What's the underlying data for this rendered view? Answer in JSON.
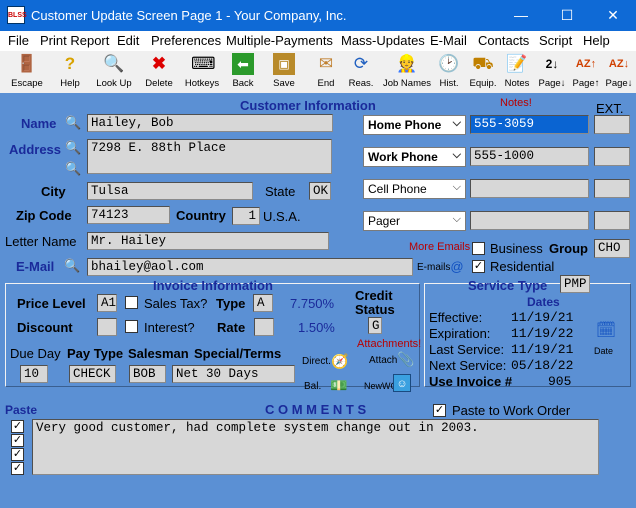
{
  "window": {
    "title": "Customer Update Screen Page 1 - Your Company, Inc.",
    "app_icon_text": "BLSS",
    "minimize": "—",
    "maximize": "☐",
    "close": "✕"
  },
  "menu": [
    "File",
    "Print Report",
    "Edit",
    "Preferences",
    "Multiple-Payments",
    "Mass-Updates",
    "E-Mail",
    "Contacts",
    "Script",
    "Help"
  ],
  "toolbar": {
    "escape": "Escape",
    "help": "Help",
    "lookup": "Look Up",
    "delete": "Delete",
    "hotkeys": "Hotkeys",
    "back": "Back",
    "save": "Save",
    "end": "End",
    "reas": "Reas.",
    "jobnames": "Job Names",
    "hist": "Hist.",
    "equip": "Equip.",
    "notes": "Notes",
    "page_down": "Page↓",
    "page_up": "Page↑",
    "page_down2": "Page↓"
  },
  "customer": {
    "section_title": "Customer Information",
    "name_label": "Name",
    "name": "Hailey, Bob",
    "address_label": "Address",
    "address": "7298 E. 88th Place",
    "city_label": "City",
    "city": "Tulsa",
    "state_label": "State",
    "state": "OK",
    "zip_label": "Zip Code",
    "zip": "74123",
    "country_label": "Country",
    "country_code": "1",
    "country": "U.S.A.",
    "letter_label": "Letter Name",
    "letter_name": "Mr. Hailey",
    "email_label": "E-Mail",
    "email": "bhailey@aol.com",
    "emails_label": "E-mails"
  },
  "phones": {
    "notes_label": "Notes!",
    "ext_label": "EXT.",
    "home_label": "Home Phone",
    "home": "555-3059",
    "work_label": "Work Phone",
    "work": "555-1000",
    "cell_label": "Cell Phone",
    "cell": "",
    "pager_label": "Pager",
    "pager": "",
    "more_emails": "More Emails",
    "business_label": "Business",
    "group_label": "Group",
    "group": "CHO",
    "residential_label": "Residential"
  },
  "invoice": {
    "section_title": "Invoice Information",
    "price_level_label": "Price Level",
    "price_level": "A1",
    "sales_tax_label": "Sales Tax?",
    "type_label": "Type",
    "type": "A",
    "tax_pct": "7.750%",
    "discount_label": "Discount",
    "interest_label": "Interest?",
    "rate_label": "Rate",
    "rate_pct": "1.50%",
    "credit_label": "Credit",
    "status_label": "Status",
    "credit_status": "G",
    "attachments_label": "Attachments!",
    "due_day_label": "Due Day",
    "due_day": "10",
    "pay_type_label": "Pay Type",
    "pay_type": "CHECK",
    "salesman_label": "Salesman",
    "salesman": "BOB",
    "terms_label": "Special/Terms",
    "terms": "Net 30 Days",
    "direct_label": "Direct.",
    "attach_label": "Attach",
    "bal_label": "Bal.",
    "newwo_label": "NewWO"
  },
  "service": {
    "type_label": "Service Type",
    "type": "PMP",
    "dates_label": "Dates",
    "effective_label": "Effective:",
    "effective": "11/19/21",
    "expiration_label": "Expiration:",
    "expiration": "11/19/22",
    "last_label": "Last Service:",
    "last": "11/19/21",
    "next_label": "Next Service:",
    "next": "05/18/22",
    "use_invoice_label": "Use Invoice #",
    "use_invoice": "905",
    "date_label": "Date"
  },
  "comments": {
    "paste_label": "Paste",
    "title": "C O M M E N T S",
    "paste_wo_label": "Paste to Work Order",
    "text": "Very good customer, had complete system change out in 2003."
  }
}
